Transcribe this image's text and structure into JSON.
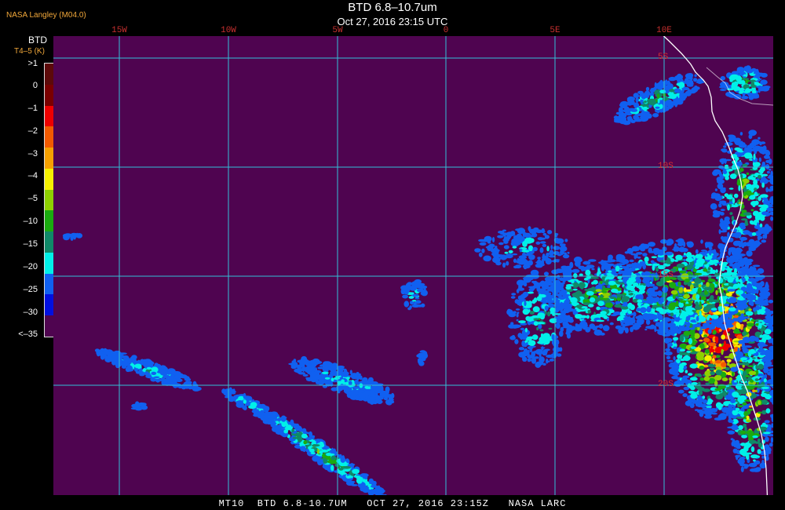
{
  "credit": "NASA Langley (M04.0)",
  "title": "BTD 6.8–10.7um",
  "subtitle": "Oct 27, 2016 23:15 UTC",
  "legend": {
    "title": "BTD",
    "units": "T4–5 (K)",
    "ticks": [
      ">1",
      "0",
      "–1",
      "–2",
      "–3",
      "–4",
      "–5",
      "–10",
      "–15",
      "–20",
      "–25",
      "–30",
      "<–35"
    ],
    "colors": [
      "#5c0a0a",
      "#7a0000",
      "#ee0000",
      "#f25a00",
      "#f5a000",
      "#f5f000",
      "#8ed000",
      "#1aaa10",
      "#108868",
      "#00f0e8",
      "#1060f0",
      "#0010e0",
      "#4f0450"
    ]
  },
  "map": {
    "background": "#4f0450",
    "grid_color": "#33c0d8",
    "coast_color": "#ffffff",
    "longitude_labels": [
      "15W",
      "10W",
      "5W",
      "0",
      "5E",
      "10E"
    ],
    "latitude_labels": [
      "5S",
      "10S",
      "15S",
      "20S"
    ]
  },
  "footer": "MT10  BTD 6.8-10.7UM   OCT 27, 2016 23:15Z   NASA LARC"
}
